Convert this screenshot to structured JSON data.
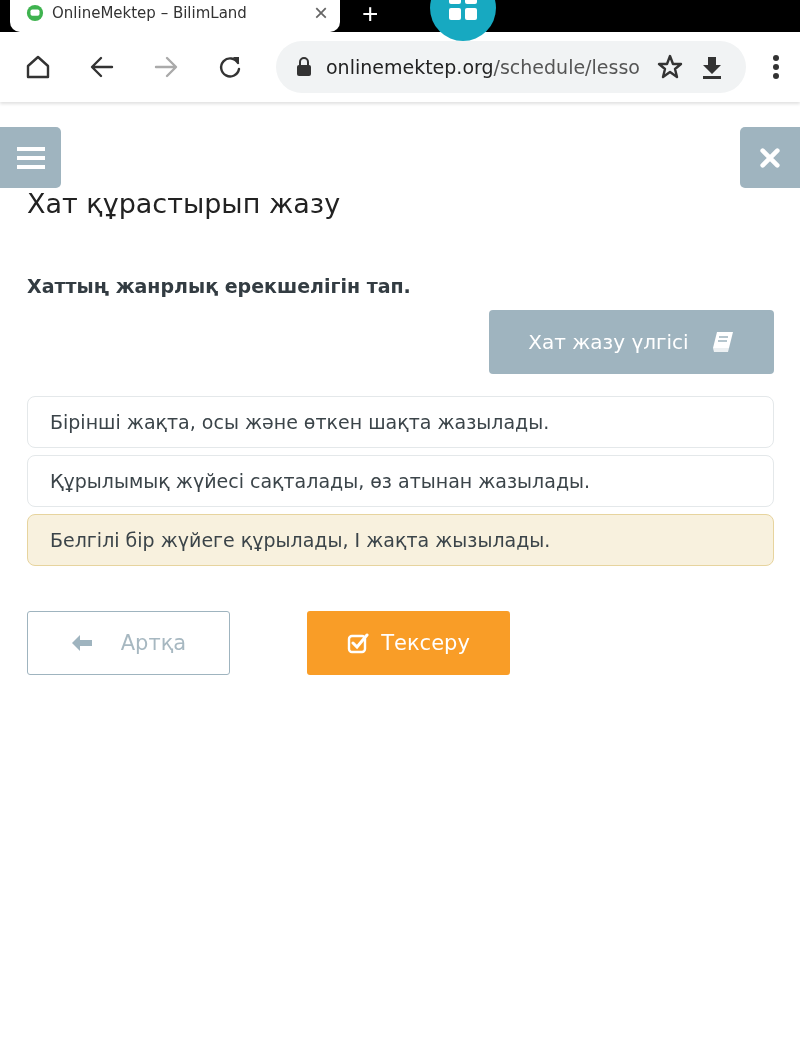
{
  "browser": {
    "tab": {
      "title": "OnlineMektep – BilimLand",
      "close": "×"
    },
    "new_tab": "+",
    "url": {
      "host": "onlinemektep.org",
      "path": "/schedule/lesso"
    }
  },
  "page": {
    "title": "Хат құрастырып жазу",
    "question": "Хаттың жанрлық ерекшелігін тап.",
    "sample_button": "Хат жазу үлгісі",
    "options": [
      {
        "text": "Бірінші жақта, осы және өткен шақта жазылады.",
        "selected": false
      },
      {
        "text": "Құрылымық жүйесі сақталады, өз атынан жазылады.",
        "selected": false
      },
      {
        "text": "Белгілі бір жүйеге құрылады, І жақта жызылады.",
        "selected": true
      }
    ],
    "back_button": "Артқа",
    "check_button": "Тексеру"
  }
}
